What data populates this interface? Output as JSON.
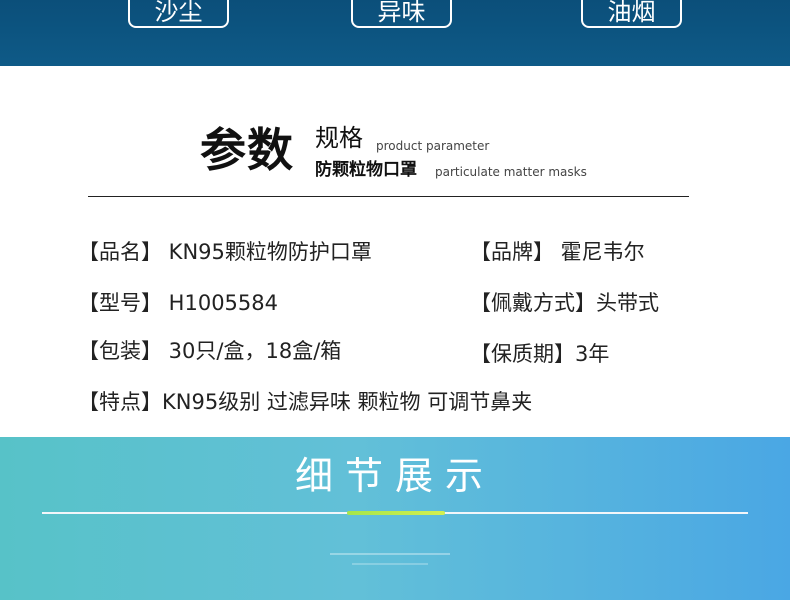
{
  "top_tags": [
    "沙尘",
    "异味",
    "油烟"
  ],
  "parameter_heading": {
    "title": "参数",
    "spec_cn": "规格",
    "spec_en": "product parameter",
    "product_cn": "防颗粒物口罩",
    "product_en": "particulate matter masks"
  },
  "specs": {
    "pinming": "【品名】 KN95颗粒物防护口罩",
    "pinpai": "【品牌】 霍尼韦尔",
    "xinghao": "【型号】 H1005584",
    "peidai": "【佩戴方式】头带式",
    "baozhuang": "【包装】 30只/盒，18盒/箱",
    "baozhiqi": "【保质期】3年",
    "tedian": "【特点】KN95级别 过滤异味 颗粒物 可调节鼻夹"
  },
  "details": {
    "title": "细节展示"
  },
  "colors": {
    "top_band": "#0e5a87",
    "bottom_gradient_start": "#57c2c8",
    "bottom_gradient_end": "#4aa7e4",
    "accent": "#c4ea4c"
  }
}
